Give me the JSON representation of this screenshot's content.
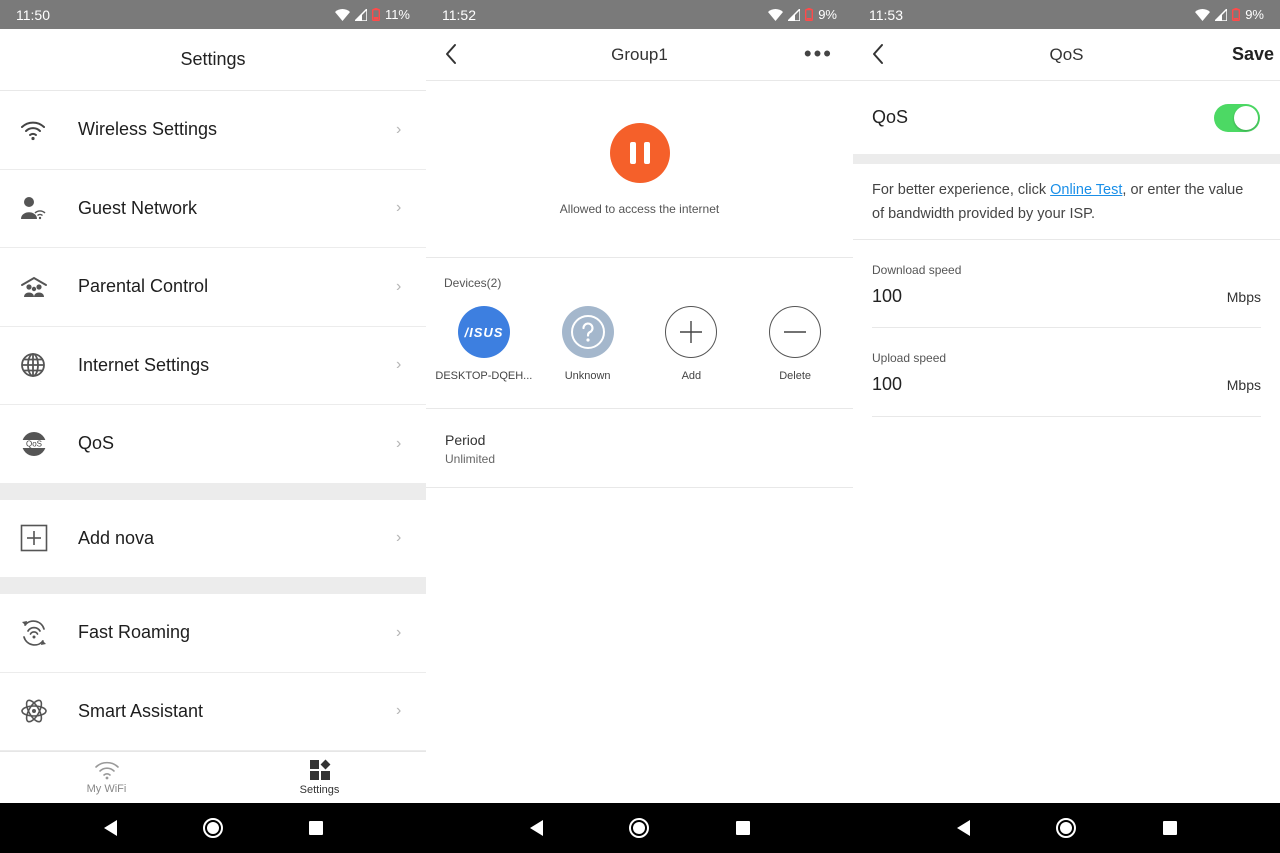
{
  "screens": [
    {
      "status": {
        "time": "11:50",
        "battery": "11%",
        "battery_color": "#ff4a4a"
      },
      "header": {
        "title": "Settings"
      },
      "items": [
        {
          "label": "Wireless Settings",
          "icon": "wifi-icon"
        },
        {
          "label": "Guest Network",
          "icon": "guest-icon"
        },
        {
          "label": "Parental Control",
          "icon": "parental-control-icon"
        },
        {
          "label": "Internet Settings",
          "icon": "globe-icon"
        },
        {
          "label": "QoS",
          "icon": "qos-icon",
          "icon_text": "QoS"
        },
        {
          "label": "Add nova",
          "icon": "add-box-icon"
        },
        {
          "label": "Fast Roaming",
          "icon": "roaming-icon"
        },
        {
          "label": "Smart Assistant",
          "icon": "atom-icon"
        }
      ],
      "tabs": [
        {
          "label": "My WiFi",
          "icon": "wifi-icon",
          "active": false
        },
        {
          "label": "Settings",
          "icon": "grid-icon",
          "active": true
        }
      ]
    },
    {
      "status": {
        "time": "11:52",
        "battery": "9%",
        "battery_color": "#ff4a4a"
      },
      "header": {
        "title": "Group1"
      },
      "pause": {
        "status": "Allowed to access the internet",
        "color": "#f5602a"
      },
      "devices_title": "Devices(2)",
      "devices": [
        {
          "name": "DESKTOP-DQEH...",
          "icon": "asus-logo-icon",
          "logo_text": "/ISUS",
          "color": "#3d7fe0"
        },
        {
          "name": "Unknown",
          "icon": "question-icon",
          "color": "#a4b7cc"
        },
        {
          "name": "Add",
          "icon": "plus-icon"
        },
        {
          "name": "Delete",
          "icon": "minus-icon"
        }
      ],
      "period": {
        "title": "Period",
        "value": "Unlimited"
      }
    },
    {
      "status": {
        "time": "11:53",
        "battery": "9%",
        "battery_color": "#ff4a4a"
      },
      "header": {
        "title": "QoS",
        "save": "Save"
      },
      "qos": {
        "label": "QoS",
        "enabled": true,
        "toggle_color": "#4cd964"
      },
      "info": {
        "before": "For better experience, click ",
        "link": "Online Test",
        "after": ", or enter the value of bandwidth provided by your ISP."
      },
      "download": {
        "label": "Download speed",
        "value": "100",
        "unit": "Mbps"
      },
      "upload": {
        "label": "Upload speed",
        "value": "100",
        "unit": "Mbps"
      }
    }
  ]
}
